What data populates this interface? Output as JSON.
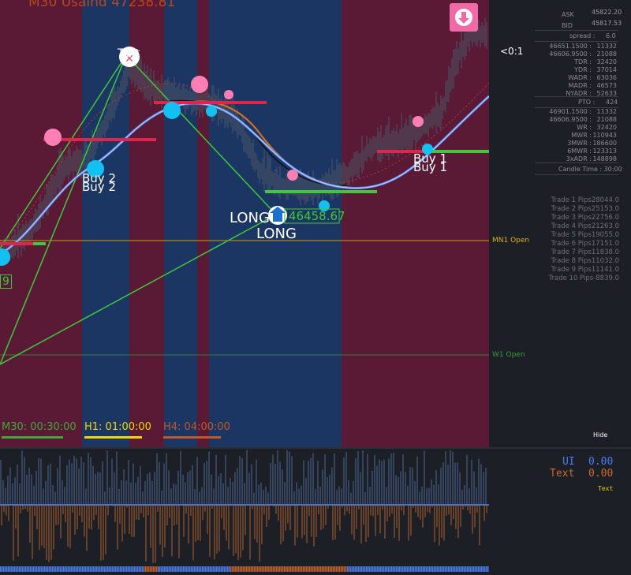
{
  "chart": {
    "title": "M30 Usaind 47238.81",
    "colors": {
      "bull": "#5a1a35",
      "bear": "#1c3663",
      "up": "#00e000",
      "ma": "#4a7cf0"
    },
    "labels": {
      "text_top": "Text",
      "buy2_a": "Buy 2",
      "buy2_b": "Buy 2",
      "long_a": "LONG",
      "long_b": "LONG",
      "long_price": "46458.67",
      "buy1_a": "Buy 1",
      "buy1_b": "Buy 1",
      "left_tag": "9",
      "ratio": "<0:1",
      "mn1": "MN1 Open",
      "w1": "W1 Open",
      "hide": "Hide"
    },
    "timeframes": [
      {
        "label": "M30: 00:30:00",
        "color": "#3ea83a"
      },
      {
        "label": "H1: 01:00:00",
        "color": "#f1d700"
      },
      {
        "label": "H4: 04:00:00",
        "color": "#c0582a"
      }
    ]
  },
  "panel": {
    "ask_label": "ASK",
    "ask_value": "45822.20",
    "bid_label": "BID",
    "bid_value": "45817.53",
    "spread_label": "spread :",
    "spread_value": "6.0",
    "rows1": [
      {
        "a": "46651.1500 :",
        "b": "11332"
      },
      {
        "a": "46606.9500 :",
        "b": "21088"
      },
      {
        "a": "TDR :",
        "b": "32420"
      },
      {
        "a": "YDR :",
        "b": "37014"
      },
      {
        "a": "WADR :",
        "b": "63036"
      },
      {
        "a": "MADR :",
        "b": "46573"
      },
      {
        "a": "NYADR :",
        "b": "52633"
      }
    ],
    "pto_label": "PTO :",
    "pto_value": "424",
    "rows2": [
      {
        "a": "46901.1500 :",
        "b": "11332"
      },
      {
        "a": "46606.9500 :",
        "b": "21088"
      },
      {
        "a": "WR :",
        "b": "32420"
      },
      {
        "a": "MWR :",
        "b": "110943"
      },
      {
        "a": "3MWR :",
        "b": "186600"
      },
      {
        "a": "6MWR :",
        "b": "123313"
      },
      {
        "a": "3xADR :",
        "b": "148898"
      }
    ],
    "candle_time": "Candle Time : 30:00",
    "trades": [
      "Trade 1 Pips28044.0",
      "Trade 2 Pips25153.0",
      "Trade 3 Pips22756.0",
      "Trade 4 Pips21263.0",
      "Trade 5 Pips19055.0",
      "Trade 6 Pips17151.0",
      "Trade 7 Pips11838.0",
      "Trade 8 Pips11032.0",
      "Trade 9 Pips11141.0",
      "Trade 10 Pips-8839.0"
    ]
  },
  "indicator": {
    "ui_label": "UI",
    "ui_value": "0.00",
    "text_label": "Text",
    "text_value": "0.00",
    "small_text": "Text"
  }
}
